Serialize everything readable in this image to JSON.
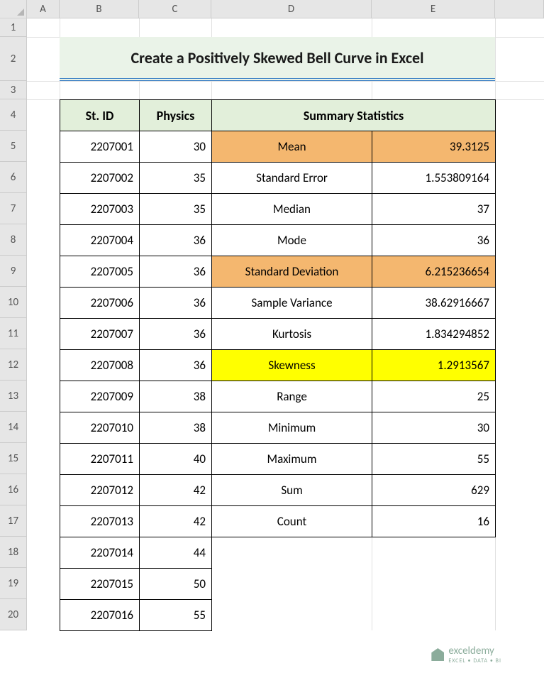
{
  "columns": [
    "A",
    "B",
    "C",
    "D",
    "E"
  ],
  "rows": [
    "1",
    "2",
    "3",
    "4",
    "5",
    "6",
    "7",
    "8",
    "9",
    "10",
    "11",
    "12",
    "13",
    "14",
    "15",
    "16",
    "17",
    "18",
    "19",
    "20"
  ],
  "title": "Create a Positively Skewed Bell Curve in Excel",
  "headers": {
    "stid": "St. ID",
    "physics": "Physics",
    "summary": "Summary Statistics"
  },
  "data": [
    {
      "id": "2207001",
      "phys": "30",
      "stat": "Mean",
      "val": "39.3125",
      "hl": "orange"
    },
    {
      "id": "2207002",
      "phys": "35",
      "stat": "Standard Error",
      "val": "1.553809164",
      "hl": ""
    },
    {
      "id": "2207003",
      "phys": "35",
      "stat": "Median",
      "val": "37",
      "hl": ""
    },
    {
      "id": "2207004",
      "phys": "36",
      "stat": "Mode",
      "val": "36",
      "hl": ""
    },
    {
      "id": "2207005",
      "phys": "36",
      "stat": "Standard Deviation",
      "val": "6.215236654",
      "hl": "orange"
    },
    {
      "id": "2207006",
      "phys": "36",
      "stat": "Sample Variance",
      "val": "38.62916667",
      "hl": ""
    },
    {
      "id": "2207007",
      "phys": "36",
      "stat": "Kurtosis",
      "val": "1.834294852",
      "hl": ""
    },
    {
      "id": "2207008",
      "phys": "36",
      "stat": "Skewness",
      "val": "1.2913567",
      "hl": "yellow"
    },
    {
      "id": "2207009",
      "phys": "38",
      "stat": "Range",
      "val": "25",
      "hl": ""
    },
    {
      "id": "2207010",
      "phys": "38",
      "stat": "Minimum",
      "val": "30",
      "hl": ""
    },
    {
      "id": "2207011",
      "phys": "40",
      "stat": "Maximum",
      "val": "55",
      "hl": ""
    },
    {
      "id": "2207012",
      "phys": "42",
      "stat": "Sum",
      "val": "629",
      "hl": ""
    },
    {
      "id": "2207013",
      "phys": "42",
      "stat": "Count",
      "val": "16",
      "hl": ""
    },
    {
      "id": "2207014",
      "phys": "44"
    },
    {
      "id": "2207015",
      "phys": "50"
    },
    {
      "id": "2207016",
      "phys": "55"
    }
  ],
  "watermark": {
    "brand": "exceldemy",
    "tagline": "EXCEL • DATA • BI"
  }
}
